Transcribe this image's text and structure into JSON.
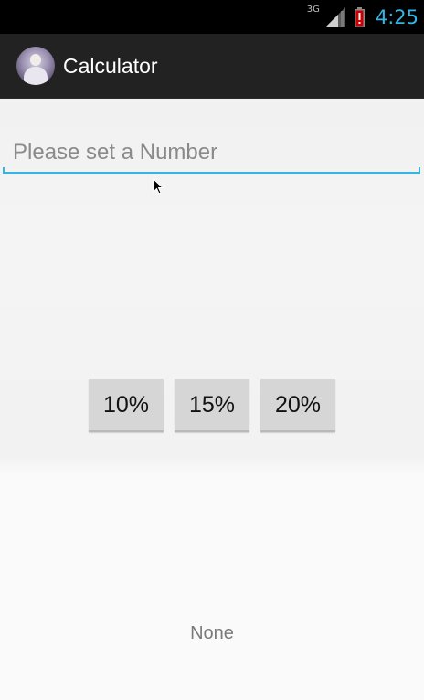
{
  "status_bar": {
    "network_type": "3G",
    "time": "4:25",
    "signal_icon": "cell-signal-icon",
    "battery_icon": "battery-alert-icon"
  },
  "action_bar": {
    "title": "Calculator",
    "app_icon": "app-avatar-icon"
  },
  "input": {
    "value": "",
    "placeholder": "Please set a Number"
  },
  "buttons": [
    {
      "label": "10%"
    },
    {
      "label": "15%"
    },
    {
      "label": "20%"
    }
  ],
  "result": {
    "text": "None"
  },
  "colors": {
    "accent": "#33b5e5",
    "action_bar": "#222222",
    "battery_alert": "#cc0000",
    "button_bg": "#d6d6d6"
  }
}
